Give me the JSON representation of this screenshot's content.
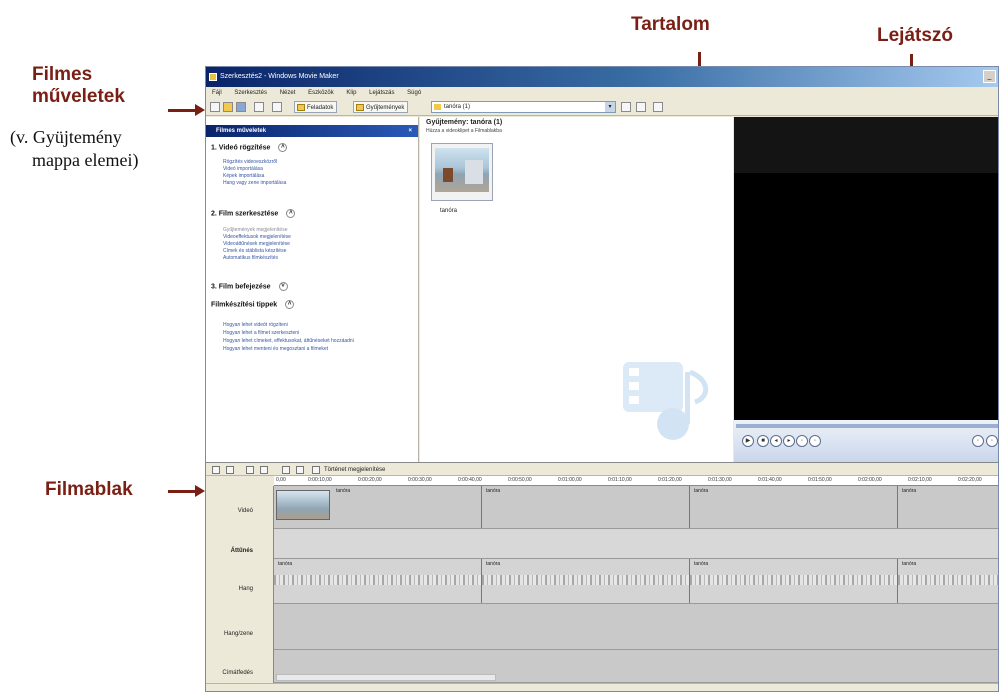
{
  "annotations": {
    "film_tasks_line1": "Filmes",
    "film_tasks_line2": "műveletek",
    "collection_note_line1": "(v. Gyüjtemény",
    "collection_note_line2": "mappa elemei)",
    "content": "Tartalom",
    "player": "Lejátszó",
    "timeline": "Filmablak"
  },
  "window": {
    "title": "Szerkesztés2 - Windows Movie Maker",
    "menu": [
      "Fájl",
      "Szerkesztés",
      "Nézet",
      "Eszközök",
      "Klip",
      "Lejátszás",
      "Súgó"
    ]
  },
  "toolbar": {
    "tasks_label": "Feladatok",
    "collections_label": "Gyűjtemények",
    "collection_combo_value": "tanóra (1)"
  },
  "task_pane": {
    "header": "Filmes műveletek",
    "sections": [
      {
        "title": "1. Videó rögzítése",
        "links": [
          "Rögzítés videoeszközről",
          "Videó importálása",
          "Képek importálása",
          "Hang vagy zene importálása"
        ]
      },
      {
        "title": "2. Film szerkesztése",
        "links": [
          "Gyűjtemények megjelenítése",
          "Videoeffektusok megjelenítése",
          "Videoáttűnések megjelenítése",
          "Címek és stáblista készítése",
          "Automatikus filmkészítés"
        ]
      },
      {
        "title": "3. Film befejezése",
        "links": []
      },
      {
        "title": "Filmkészítési tippek",
        "links": [
          "Hogyan lehet videót rögzíteni",
          "Hogyan lehet a filmet szerkeszteni",
          "Hogyan lehet címeket, effektusokat, áttűnéseket hozzáadni",
          "Hogyan lehet menteni és megosztani a filmeket"
        ]
      }
    ]
  },
  "content": {
    "title": "Gyűjtemény: tanóra (1)",
    "subtitle": "Húzza a videoklipet a Filmablakba",
    "clip_label": "tanóra"
  },
  "timeline": {
    "toolbar_label": "Történet megjelenítése",
    "ruler_ticks": [
      "0,00",
      "0:00:10,00",
      "0:00:20,00",
      "0:00:30,00",
      "0:00:40,00",
      "0:00:50,00",
      "0:01:00,00",
      "0:01:10,00",
      "0:01:20,00",
      "0:01:30,00",
      "0:01:40,00",
      "0:01:50,00",
      "0:02:00,00",
      "0:02:10,00",
      "0:02:20,00"
    ],
    "tracks": {
      "video": "Videó",
      "transition": "Áttűnés",
      "audio": "Hang",
      "music": "Hang/zene",
      "title_overlay": "Címátfedés"
    },
    "clip_name": "tanóra"
  }
}
